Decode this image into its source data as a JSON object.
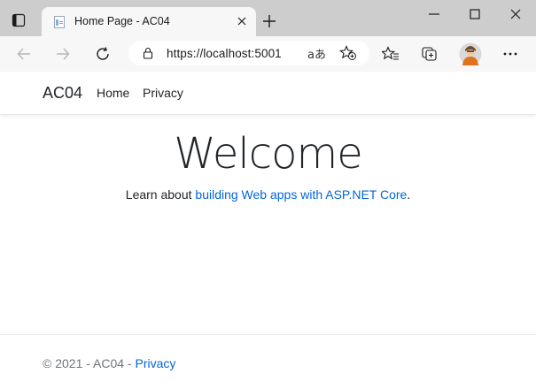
{
  "browser": {
    "tab_title": "Home Page - AC04",
    "url_display": "https://localhost:5001",
    "read_aloud_glyph": "aあ",
    "icons": {
      "tab_actions": "tab-actions-icon",
      "favicon": "page-favicon-icon",
      "tab_close": "close-icon",
      "new_tab": "plus-icon",
      "minimize": "minimize-icon",
      "maximize": "maximize-icon",
      "close_window": "close-icon",
      "back": "arrow-left-icon",
      "forward": "arrow-right-icon",
      "refresh": "refresh-icon",
      "lock": "lock-icon",
      "add_favorite": "star-plus-icon",
      "favorites": "favorites-icon",
      "collections": "collections-icon",
      "profile": "avatar",
      "more": "more-icon"
    }
  },
  "site": {
    "brand": "AC04",
    "nav": [
      {
        "label": "Home"
      },
      {
        "label": "Privacy"
      }
    ],
    "main": {
      "heading": "Welcome",
      "learn_prefix": "Learn about ",
      "learn_link": "building Web apps with ASP.NET Core",
      "learn_suffix": "."
    },
    "footer": {
      "text": "© 2021 - AC04 - ",
      "privacy_link": "Privacy"
    }
  },
  "colors": {
    "link": "#0366d6",
    "tabstrip": "#cdcdcd",
    "toolbar": "#f7f7f7",
    "text": "#212529",
    "muted": "#6c757d"
  }
}
